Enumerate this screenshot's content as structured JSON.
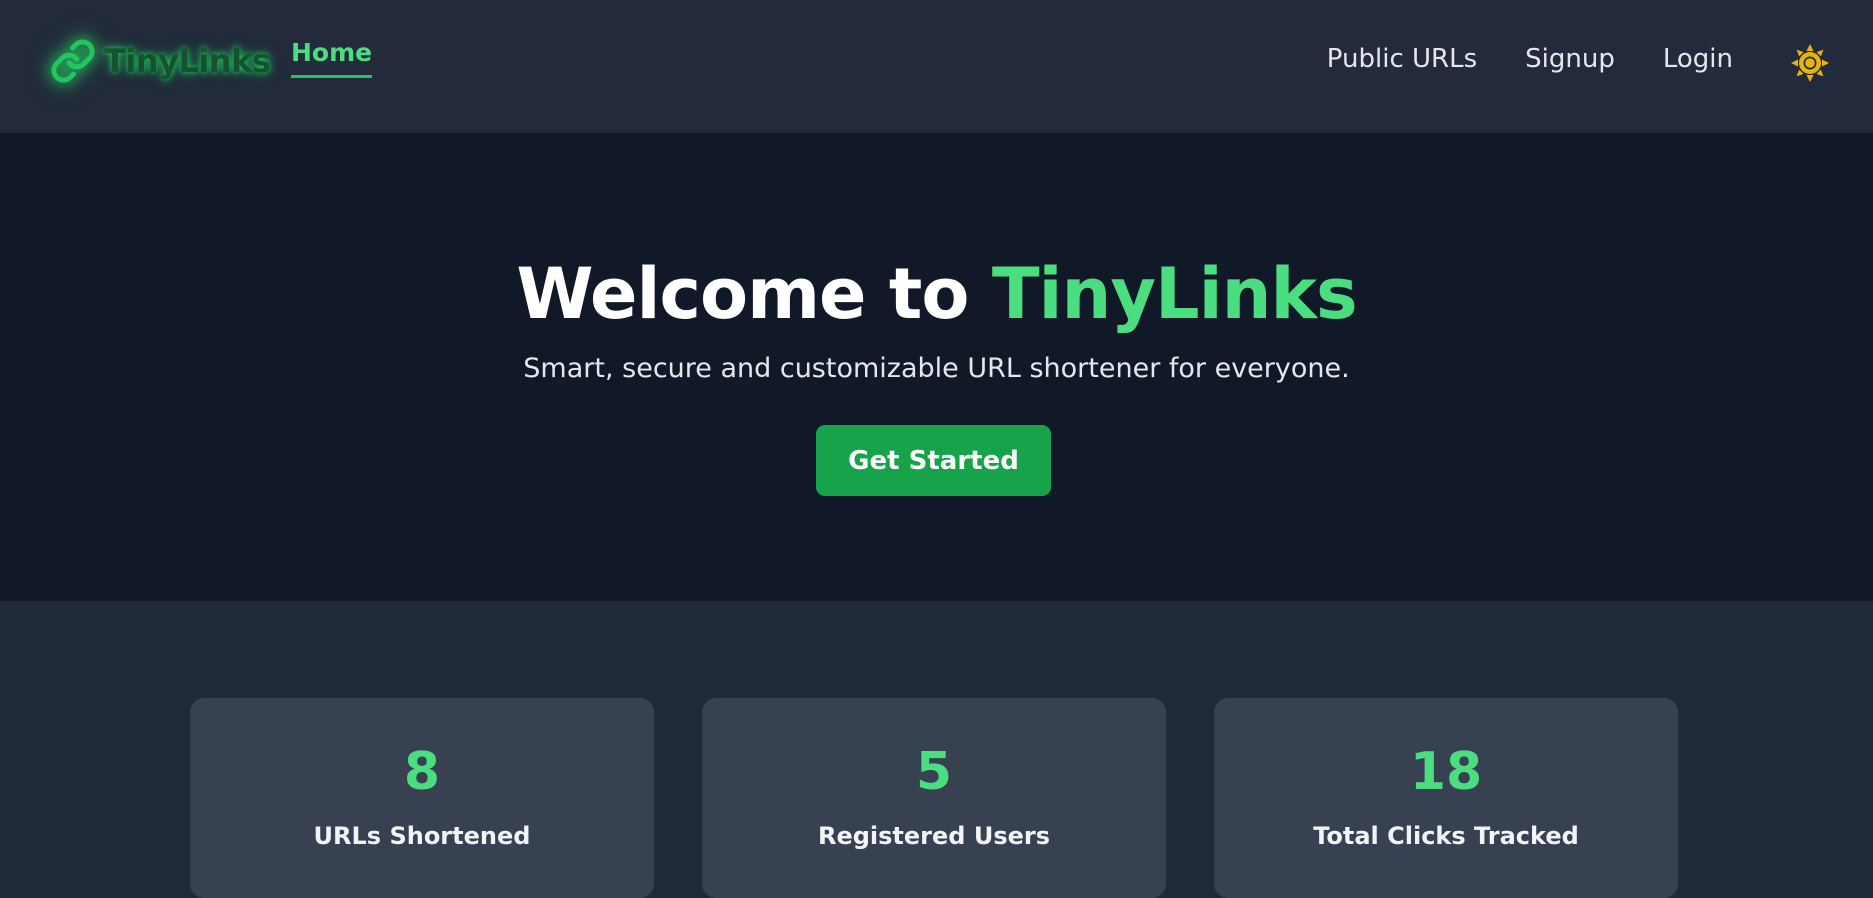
{
  "navbar": {
    "brand": "TinyLinks",
    "home_label": "Home",
    "links": [
      "Public URLs",
      "Signup",
      "Login"
    ],
    "brand_icon": "link-icon",
    "theme_icon": "sun-icon"
  },
  "hero": {
    "title_prefix": "Welcome to ",
    "title_accent": "TinyLinks",
    "subtitle": "Smart, secure and customizable URL shortener for everyone.",
    "cta_label": "Get Started"
  },
  "stats": [
    {
      "value": "8",
      "label": "URLs Shortened"
    },
    {
      "value": "5",
      "label": "Registered Users"
    },
    {
      "value": "18",
      "label": "Total Clicks Tracked"
    }
  ],
  "colors": {
    "accent": "#4ade80",
    "button": "#16a34a",
    "navbar_bg": "#222a3b",
    "hero_bg": "#111827",
    "card_bg": "#374151",
    "sun": "#eab308"
  }
}
